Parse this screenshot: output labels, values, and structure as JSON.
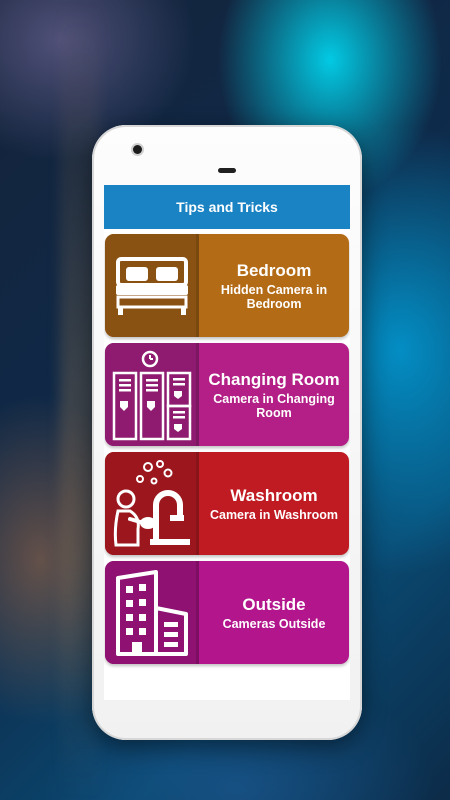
{
  "app_bar": {
    "title": "Tips and Tricks"
  },
  "colors": {
    "app_bar": "#1a83c4",
    "bedroom": "#b46b15",
    "bedroom_icon": "#8a5212",
    "changing_room": "#b31f86",
    "changing_room_icon": "#8e1b6f",
    "washroom": "#c01b22",
    "washroom_icon": "#9b171d",
    "outside": "#b3158d",
    "outside_icon": "#8f1172"
  },
  "cards": [
    {
      "title": "Bedroom",
      "subtitle": "Hidden Camera in Bedroom",
      "icon": "bed-icon"
    },
    {
      "title": "Changing Room",
      "subtitle": "Camera in Changing Room",
      "icon": "lockers-icon"
    },
    {
      "title": "Washroom",
      "subtitle": "Camera in Washroom",
      "icon": "washing-hands-icon"
    },
    {
      "title": "Outside",
      "subtitle": "Cameras Outside",
      "icon": "buildings-icon"
    }
  ]
}
